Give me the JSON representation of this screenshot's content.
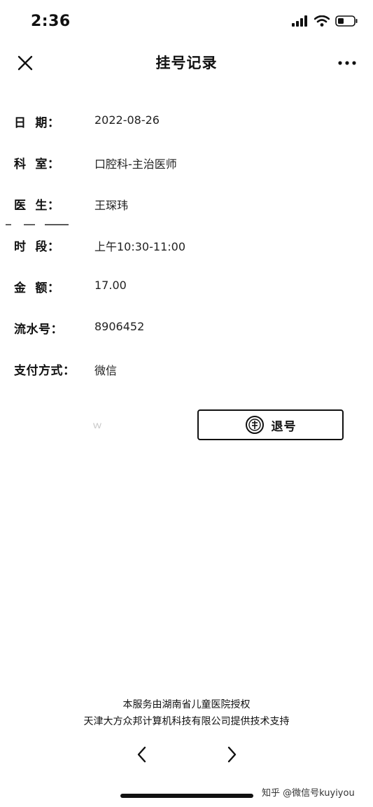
{
  "status_bar": {
    "time": "2:36"
  },
  "nav": {
    "title": "挂号记录",
    "close_icon": "close-icon",
    "more_icon": "more-icon"
  },
  "info": [
    {
      "label": "日  期：",
      "value": "2022-08-26"
    },
    {
      "label": "科  室：",
      "value": "口腔科-主治医师"
    },
    {
      "label": "医  生：",
      "value": "王琛玮"
    },
    {
      "label": "时  段：",
      "value": "上午10:30-11:00"
    },
    {
      "label": "金  额：",
      "value": "17.00"
    },
    {
      "label": "流水号：",
      "value": "8906452"
    },
    {
      "label": "支付方式：",
      "value": "微信"
    }
  ],
  "actions": {
    "ghost_label": "ｗ",
    "refund_label": "退号",
    "refund_icon": "yen-circle-icon"
  },
  "footer": {
    "line1": "本服务由湖南省儿童医院授权",
    "line2": "天津大方众邦计算机科技有限公司提供技术支持"
  },
  "pager": {
    "prev_icon": "chevron-left-icon",
    "next_icon": "chevron-right-icon"
  },
  "watermark": "知乎 @微信号kuyiyou"
}
